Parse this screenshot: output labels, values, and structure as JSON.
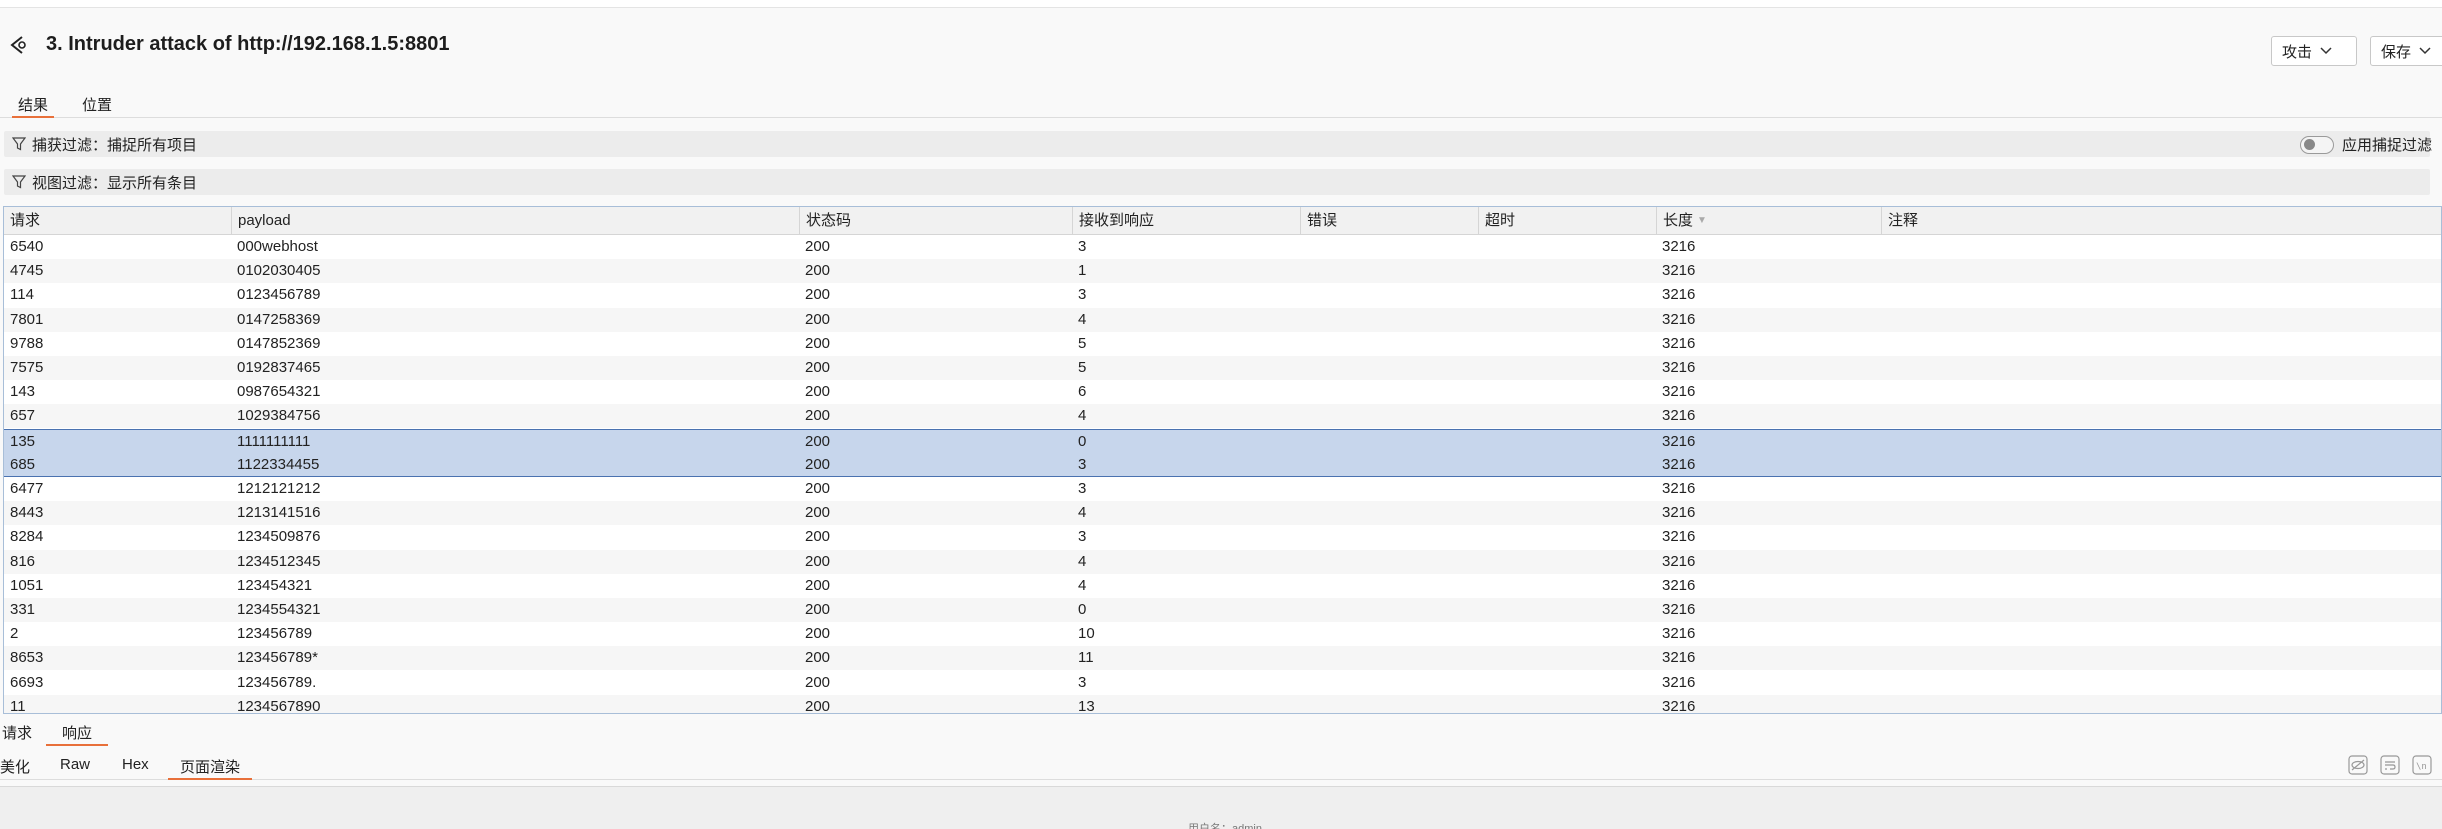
{
  "window": {
    "title": "3. Intruder attack of http://192.168.1.5:8801",
    "attack_button": "攻击",
    "save_button": "保存"
  },
  "tabs": [
    {
      "label": "结果",
      "active": true
    },
    {
      "label": "位置",
      "active": false
    }
  ],
  "filters": {
    "capture": "捕获过滤：捕捉所有项目",
    "view": "视图过滤：显示所有条目",
    "apply_capture_toggle": "应用捕捉过滤",
    "apply_capture_enabled": false
  },
  "table": {
    "columns": [
      "请求",
      "payload",
      "状态码",
      "接收到响应",
      "错误",
      "超时",
      "长度",
      "注释"
    ],
    "sorted_column": "长度",
    "rows": [
      [
        "6540",
        "000webhost",
        "200",
        "3",
        "",
        "",
        "3216",
        ""
      ],
      [
        "4745",
        "0102030405",
        "200",
        "1",
        "",
        "",
        "3216",
        ""
      ],
      [
        "114",
        "0123456789",
        "200",
        "3",
        "",
        "",
        "3216",
        ""
      ],
      [
        "7801",
        "0147258369",
        "200",
        "4",
        "",
        "",
        "3216",
        ""
      ],
      [
        "9788",
        "0147852369",
        "200",
        "5",
        "",
        "",
        "3216",
        ""
      ],
      [
        "7575",
        "0192837465",
        "200",
        "5",
        "",
        "",
        "3216",
        ""
      ],
      [
        "143",
        "0987654321",
        "200",
        "6",
        "",
        "",
        "3216",
        ""
      ],
      [
        "657",
        "1029384756",
        "200",
        "4",
        "",
        "",
        "3216",
        ""
      ],
      [
        "135",
        "1111111111",
        "200",
        "0",
        "",
        "",
        "3216",
        ""
      ],
      [
        "685",
        "1122334455",
        "200",
        "3",
        "",
        "",
        "3216",
        ""
      ],
      [
        "6477",
        "1212121212",
        "200",
        "3",
        "",
        "",
        "3216",
        ""
      ],
      [
        "8443",
        "1213141516",
        "200",
        "4",
        "",
        "",
        "3216",
        ""
      ],
      [
        "8284",
        "1234509876",
        "200",
        "3",
        "",
        "",
        "3216",
        ""
      ],
      [
        "816",
        "1234512345",
        "200",
        "4",
        "",
        "",
        "3216",
        ""
      ],
      [
        "1051",
        "123454321",
        "200",
        "4",
        "",
        "",
        "3216",
        ""
      ],
      [
        "331",
        "1234554321",
        "200",
        "0",
        "",
        "",
        "3216",
        ""
      ],
      [
        "2",
        "123456789",
        "200",
        "10",
        "",
        "",
        "3216",
        ""
      ],
      [
        "8653",
        "123456789*",
        "200",
        "11",
        "",
        "",
        "3216",
        ""
      ],
      [
        "6693",
        "123456789.",
        "200",
        "3",
        "",
        "",
        "3216",
        ""
      ],
      [
        "11",
        "1234567890",
        "200",
        "13",
        "",
        "",
        "3216",
        ""
      ]
    ],
    "selected_rows": [
      8,
      9
    ]
  },
  "message_tabs": [
    {
      "label": "请求",
      "active": false
    },
    {
      "label": "响应",
      "active": true
    }
  ],
  "view_tabs": [
    {
      "label": "美化",
      "active": false
    },
    {
      "label": "Raw",
      "active": false
    },
    {
      "label": "Hex",
      "active": false
    },
    {
      "label": "页面渲染",
      "active": true
    }
  ],
  "toolbar_icons": [
    "hide-icon",
    "wrap-lines-icon",
    "newline-icon"
  ],
  "preview": {
    "text": "用户名：admin"
  }
}
